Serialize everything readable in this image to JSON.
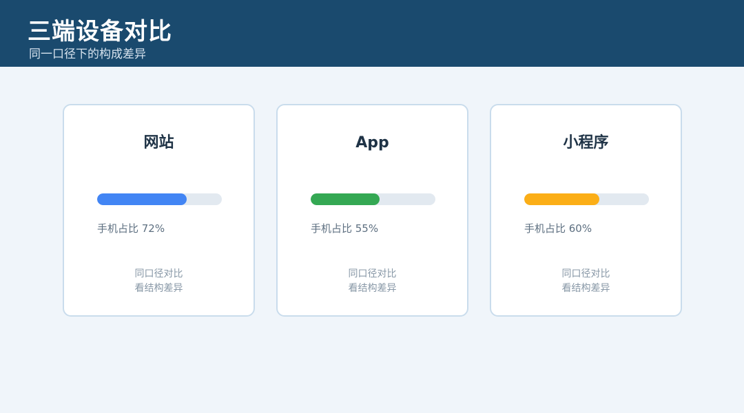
{
  "header": {
    "title": "三端设备对比",
    "subtitle": "同一口径下的构成差异"
  },
  "cards": [
    {
      "title": "网站",
      "share_label": "手机占比 72%",
      "share_value": 0.72,
      "bar_color": "#4285f4",
      "note_line1": "同口径对比",
      "note_line2": "看结构差异"
    },
    {
      "title": "App",
      "share_label": "手机占比 55%",
      "share_value": 0.55,
      "bar_color": "#34a853",
      "note_line1": "同口径对比",
      "note_line2": "看结构差异"
    },
    {
      "title": "小程序",
      "share_label": "手机占比 60%",
      "share_value": 0.6,
      "bar_color": "#fbae17",
      "note_line1": "同口径对比",
      "note_line2": "看结构差异"
    }
  ]
}
